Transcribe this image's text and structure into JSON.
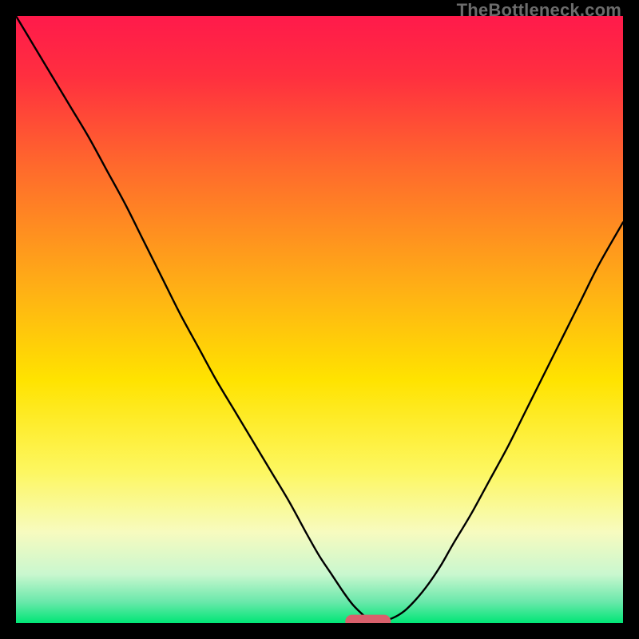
{
  "watermark": "TheBottleneck.com",
  "chart_data": {
    "type": "line",
    "title": "",
    "xlabel": "",
    "ylabel": "",
    "xlim": [
      0,
      100
    ],
    "ylim": [
      0,
      100
    ],
    "grid": false,
    "background_gradient": {
      "stops": [
        {
          "offset": 0.0,
          "color": "#ff1a4b"
        },
        {
          "offset": 0.1,
          "color": "#ff2f3f"
        },
        {
          "offset": 0.25,
          "color": "#ff6a2c"
        },
        {
          "offset": 0.45,
          "color": "#ffb015"
        },
        {
          "offset": 0.6,
          "color": "#ffe300"
        },
        {
          "offset": 0.75,
          "color": "#fdf760"
        },
        {
          "offset": 0.85,
          "color": "#f7fbbf"
        },
        {
          "offset": 0.92,
          "color": "#c9f7cf"
        },
        {
          "offset": 0.965,
          "color": "#6ae8ab"
        },
        {
          "offset": 1.0,
          "color": "#00e676"
        }
      ]
    },
    "series": [
      {
        "name": "bottleneck-curve",
        "color": "#000000",
        "stroke_width": 2.4,
        "x": [
          0,
          3,
          6,
          9,
          12,
          15,
          18,
          21,
          24,
          27,
          30,
          33,
          36,
          39,
          42,
          45,
          48,
          50,
          52,
          54,
          55.5,
          57,
          58,
          59,
          60,
          62,
          64,
          66,
          68,
          70,
          72,
          75,
          78,
          81,
          84,
          87,
          90,
          93,
          96,
          100
        ],
        "y": [
          100,
          95,
          90,
          85,
          80,
          74.5,
          69,
          63,
          57,
          51,
          45.5,
          40,
          35,
          30,
          25,
          20,
          14.5,
          11,
          8,
          5,
          3,
          1.5,
          0.7,
          0.3,
          0.3,
          0.8,
          2,
          4,
          6.5,
          9.5,
          13,
          18,
          23.5,
          29,
          35,
          41,
          47,
          53,
          59,
          66
        ]
      }
    ],
    "marker": {
      "name": "optimal-zone",
      "shape": "capsule",
      "color": "#d9606c",
      "cx": 58,
      "cy": 0,
      "width": 7.5,
      "height": 2.2
    }
  }
}
